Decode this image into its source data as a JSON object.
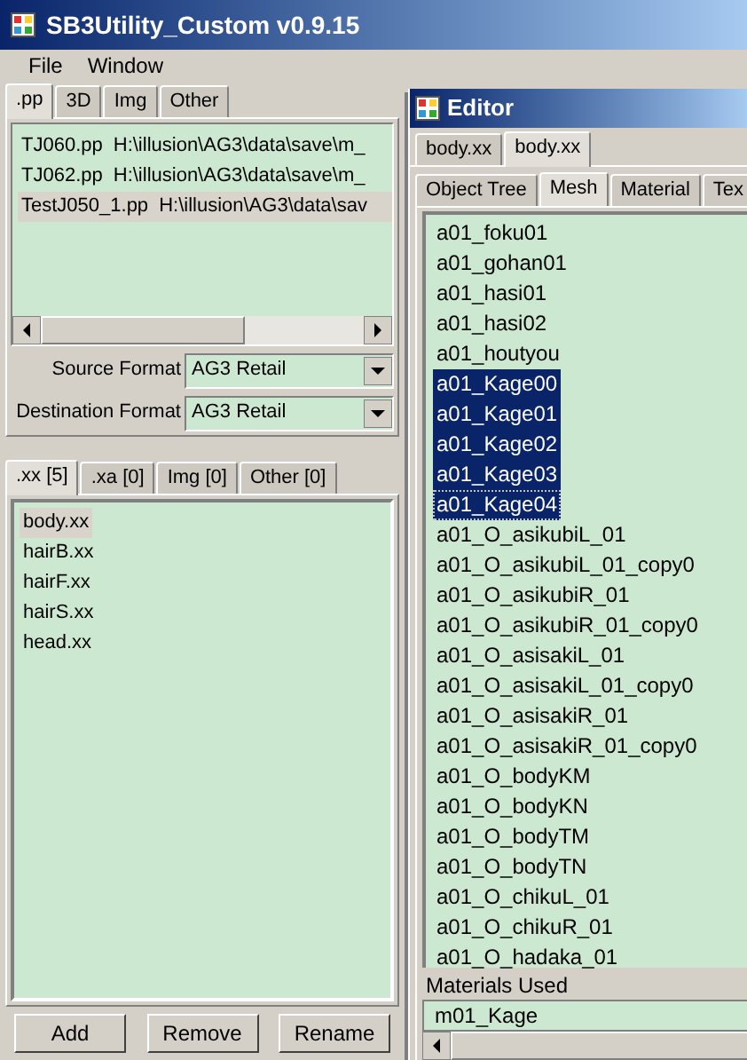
{
  "window": {
    "title": "SB3Utility_Custom v0.9.15"
  },
  "menu": [
    "File",
    "Window"
  ],
  "pp_tabs": [
    {
      "label": ".pp",
      "selected": true
    },
    {
      "label": "3D",
      "selected": false
    },
    {
      "label": "Img",
      "selected": false
    },
    {
      "label": "Other",
      "selected": false
    }
  ],
  "pp_files": [
    {
      "name": "TJ060.pp",
      "path": "H:\\illusion\\AG3\\data\\save\\m_",
      "selected": false
    },
    {
      "name": "TJ062.pp",
      "path": "H:\\illusion\\AG3\\data\\save\\m_",
      "selected": false
    },
    {
      "name": "TestJ050_1.pp",
      "path": "H:\\illusion\\AG3\\data\\sav",
      "selected": true
    }
  ],
  "formats": [
    {
      "label": "Source Format",
      "value": "AG3 Retail"
    },
    {
      "label": "Destination Format",
      "value": "AG3 Retail"
    }
  ],
  "sub_tabs": [
    {
      "label": ".xx [5]",
      "selected": true
    },
    {
      "label": ".xa [0]",
      "selected": false
    },
    {
      "label": "Img [0]",
      "selected": false
    },
    {
      "label": "Other [0]",
      "selected": false
    }
  ],
  "sub_files": [
    {
      "name": "body.xx",
      "selected": true
    },
    {
      "name": "hairB.xx",
      "selected": false
    },
    {
      "name": "hairF.xx",
      "selected": false
    },
    {
      "name": "hairS.xx",
      "selected": false
    },
    {
      "name": "head.xx",
      "selected": false
    }
  ],
  "buttons": [
    "Add",
    "Remove",
    "Rename"
  ],
  "editor": {
    "title": "Editor",
    "file_tabs": [
      {
        "label": "body.xx",
        "selected": false
      },
      {
        "label": "body.xx",
        "selected": true
      }
    ],
    "tabs": [
      {
        "label": "Object Tree",
        "selected": false
      },
      {
        "label": "Mesh",
        "selected": true
      },
      {
        "label": "Material",
        "selected": false
      },
      {
        "label": "Tex",
        "selected": false
      }
    ],
    "meshes": [
      {
        "name": "a01_foku01",
        "selected": false,
        "focused": false
      },
      {
        "name": "a01_gohan01",
        "selected": false,
        "focused": false
      },
      {
        "name": "a01_hasi01",
        "selected": false,
        "focused": false
      },
      {
        "name": "a01_hasi02",
        "selected": false,
        "focused": false
      },
      {
        "name": "a01_houtyou",
        "selected": false,
        "focused": false
      },
      {
        "name": "a01_Kage00",
        "selected": true,
        "focused": false
      },
      {
        "name": "a01_Kage01",
        "selected": true,
        "focused": false
      },
      {
        "name": "a01_Kage02",
        "selected": true,
        "focused": false
      },
      {
        "name": "a01_Kage03",
        "selected": true,
        "focused": false
      },
      {
        "name": "a01_Kage04",
        "selected": true,
        "focused": true
      },
      {
        "name": "a01_O_asikubiL_01",
        "selected": false,
        "focused": false
      },
      {
        "name": "a01_O_asikubiL_01_copy0",
        "selected": false,
        "focused": false
      },
      {
        "name": "a01_O_asikubiR_01",
        "selected": false,
        "focused": false
      },
      {
        "name": "a01_O_asikubiR_01_copy0",
        "selected": false,
        "focused": false
      },
      {
        "name": "a01_O_asisakiL_01",
        "selected": false,
        "focused": false
      },
      {
        "name": "a01_O_asisakiL_01_copy0",
        "selected": false,
        "focused": false
      },
      {
        "name": "a01_O_asisakiR_01",
        "selected": false,
        "focused": false
      },
      {
        "name": "a01_O_asisakiR_01_copy0",
        "selected": false,
        "focused": false
      },
      {
        "name": "a01_O_bodyKM",
        "selected": false,
        "focused": false
      },
      {
        "name": "a01_O_bodyKN",
        "selected": false,
        "focused": false
      },
      {
        "name": "a01_O_bodyTM",
        "selected": false,
        "focused": false
      },
      {
        "name": "a01_O_bodyTN",
        "selected": false,
        "focused": false
      },
      {
        "name": "a01_O_chikuL_01",
        "selected": false,
        "focused": false
      },
      {
        "name": "a01_O_chikuR_01",
        "selected": false,
        "focused": false
      },
      {
        "name": "a01_O_hadaka_01",
        "selected": false,
        "focused": false
      }
    ],
    "materials_label": "Materials Used",
    "materials": [
      "m01_Kage"
    ]
  }
}
